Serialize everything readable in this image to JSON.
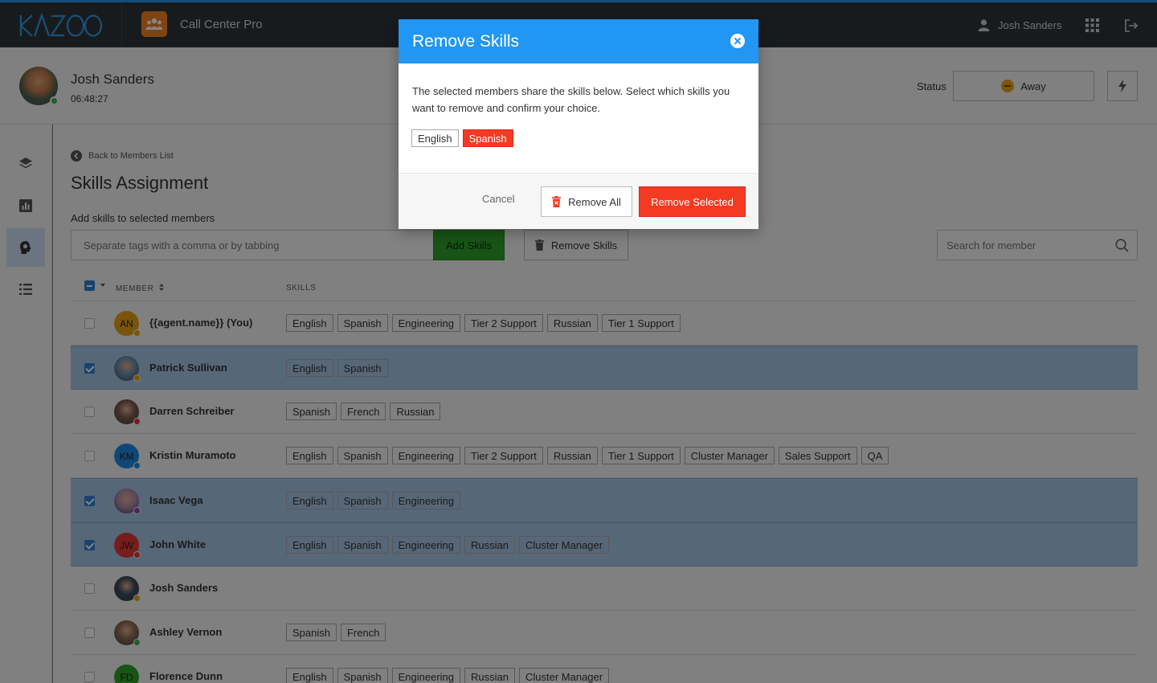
{
  "topbar": {
    "logo_text": "KAZOO",
    "app_name": "Call Center Pro",
    "user_name": "Josh Sanders",
    "icons": [
      "user-icon",
      "apps-grid-icon",
      "logout-icon"
    ]
  },
  "agent": {
    "name": "Josh Sanders",
    "timer": "06:48:27",
    "status_label": "Status",
    "status_value": "Away"
  },
  "sidebar": {
    "items": [
      {
        "icon": "layers-icon"
      },
      {
        "icon": "chart-icon"
      },
      {
        "icon": "skills-icon",
        "active": true
      },
      {
        "icon": "list-icon"
      }
    ]
  },
  "main": {
    "back_link": "Back to Members List",
    "title": "Skills Assignment",
    "add_label": "Add skills to selected members",
    "tag_placeholder": "Separate tags with a comma or by tabbing",
    "add_button": "Add Skills",
    "remove_button": "Remove Skills",
    "search_placeholder": "Search for member"
  },
  "table": {
    "headers": {
      "member": "MEMBER",
      "skills": "SKILLS"
    },
    "rows": [
      {
        "name": "{{agent.name}} (You)",
        "initials": "AN",
        "avatar_color": "#e8a317",
        "status_color": "#e8a317",
        "selected": false,
        "skills": [
          "English",
          "Spanish",
          "Engineering",
          "Tier 2 Support",
          "Russian",
          "Tier 1 Support"
        ]
      },
      {
        "name": "Patrick Sullivan",
        "initials": "",
        "avatar_color": "#6c8fb0",
        "status_color": "#e8a317",
        "selected": true,
        "skills": [
          "English",
          "Spanish"
        ]
      },
      {
        "name": "Darren Schreiber",
        "initials": "",
        "avatar_color": "#7a5a48",
        "status_color": "#e53935",
        "selected": false,
        "skills": [
          "Spanish",
          "French",
          "Russian"
        ]
      },
      {
        "name": "Kristin Muramoto",
        "initials": "KM",
        "avatar_color": "#1e88e5",
        "status_color": "#1e88e5",
        "selected": false,
        "skills": [
          "English",
          "Spanish",
          "Engineering",
          "Tier 2 Support",
          "Russian",
          "Tier 1 Support",
          "Cluster Manager",
          "Sales Support",
          "QA"
        ]
      },
      {
        "name": "Isaac Vega",
        "initials": "",
        "avatar_color": "#b58bb0",
        "status_color": "#8e44ad",
        "selected": true,
        "skills": [
          "English",
          "Spanish",
          "Engineering"
        ]
      },
      {
        "name": "John White",
        "initials": "JW",
        "avatar_color": "#e53935",
        "status_color": "#e53935",
        "selected": true,
        "skills": [
          "English",
          "Spanish",
          "Engineering",
          "Russian",
          "Cluster Manager"
        ]
      },
      {
        "name": "Josh Sanders",
        "initials": "",
        "avatar_color": "#3a4a5a",
        "status_color": "#e8a317",
        "selected": false,
        "skills": []
      },
      {
        "name": "Ashley Vernon",
        "initials": "",
        "avatar_color": "#8a6a55",
        "status_color": "#3fb34f",
        "selected": false,
        "skills": [
          "Spanish",
          "French"
        ]
      },
      {
        "name": "Florence Dunn",
        "initials": "FD",
        "avatar_color": "#2ea12a",
        "status_color": "#3fb34f",
        "selected": false,
        "skills": [
          "English",
          "Spanish",
          "Engineering",
          "Russian",
          "Cluster Manager"
        ]
      }
    ]
  },
  "modal": {
    "title": "Remove Skills",
    "description": "The selected members share the skills below. Select which skills you want to remove and confirm your choice.",
    "skills": [
      {
        "label": "English",
        "selected": false
      },
      {
        "label": "Spanish",
        "selected": true
      }
    ],
    "cancel_label": "Cancel",
    "remove_all_label": "Remove All",
    "remove_selected_label": "Remove Selected"
  },
  "colors": {
    "accent": "#2196f3",
    "danger": "#f43a22",
    "success": "#2ea12a",
    "selected_row": "#a6c5e6"
  }
}
